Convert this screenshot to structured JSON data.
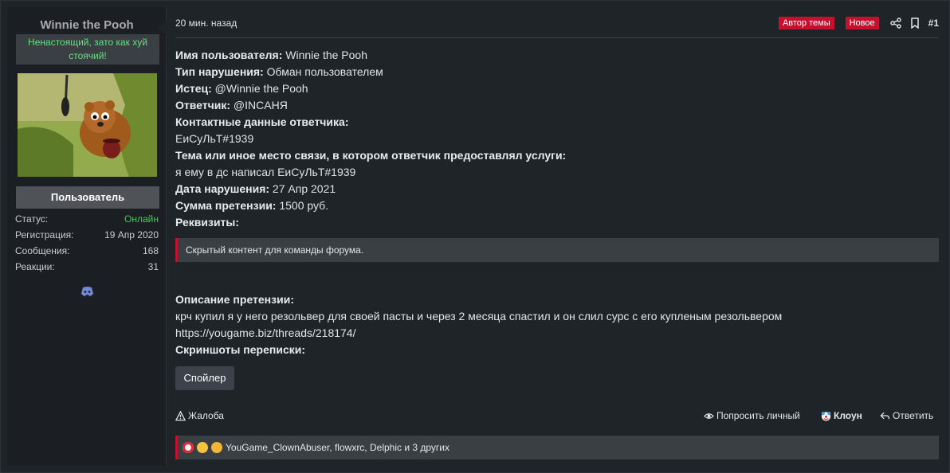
{
  "user": {
    "name": "Winnie the Pooh",
    "title": "Ненастоящий, зато как хуй стоячий!",
    "role": "Пользователь",
    "stats": [
      {
        "label": "Статус:",
        "value": "Онлайн"
      },
      {
        "label": "Регистрация:",
        "value": "19 Апр 2020"
      },
      {
        "label": "Сообщения:",
        "value": "168"
      },
      {
        "label": "Реакции:",
        "value": "31"
      }
    ]
  },
  "header": {
    "time": "20 мин. назад",
    "badge_author": "Автор темы",
    "badge_new": "Новое",
    "post_number": "#1"
  },
  "body": {
    "lines": [
      {
        "label": "Имя пользователя:",
        "value": " Winnie the Pooh"
      },
      {
        "label": "Тип нарушения:",
        "value": " Обман пользователем"
      },
      {
        "label": "Истец:",
        "value": " @Winnie the Pooh"
      },
      {
        "label": "Ответчик:",
        "value": " @INCAНЯ"
      },
      {
        "label": "Контактные данные ответчика:",
        "value": ""
      },
      {
        "label": "",
        "value": "ЕиСуЛьТ#1939"
      },
      {
        "label": "Тема или иное место связи, в котором ответчик предоставлял услуги:",
        "value": ""
      },
      {
        "label": "",
        "value": "я ему в дс написал ЕиСуЛьТ#1939"
      },
      {
        "label": "Дата нарушения:",
        "value": " 27 Апр 2021"
      },
      {
        "label": "Сумма претензии:",
        "value": " 1500 руб."
      },
      {
        "label": "Реквизиты:",
        "value": ""
      }
    ],
    "hidden_content": "Скрытый контент для команды форума.",
    "desc_lines": [
      {
        "label": "Описание претензии:",
        "value": ""
      },
      {
        "label": "",
        "value": "крч купил я у него резольвер для своей пасты и через 2 месяца спастил и он слил сурс с его купленым резольвером"
      },
      {
        "label": "",
        "value": "https://yougame.biz/threads/218174/"
      },
      {
        "label": "Скриншоты переписки:",
        "value": ""
      }
    ],
    "spoiler_label": "Спойлер"
  },
  "actions": {
    "report": "Жалоба",
    "ask_private": "Попросить личный",
    "clown": "Клоун",
    "reply": "Ответить"
  },
  "reactions": {
    "text": "YouGame_ClownAbuser, flowxrc, Delphic и 3 других"
  },
  "colors": {
    "accent": "#c8102e",
    "online": "#3fcf49",
    "title_green": "#62e07e"
  }
}
